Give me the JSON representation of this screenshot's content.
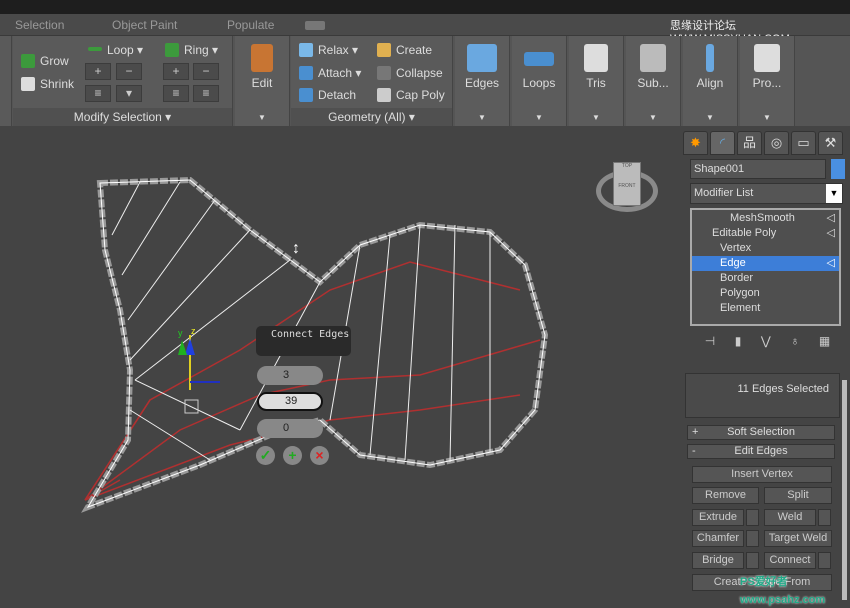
{
  "tabs": [
    "Selection",
    "Object Paint",
    "Populate"
  ],
  "modify_selection": {
    "title": "Modify Selection",
    "grow": "Grow",
    "shrink": "Shrink",
    "loop": "Loop",
    "ring": "Ring"
  },
  "edit": {
    "label": "Edit"
  },
  "geometry": {
    "title": "Geometry (All)",
    "relax": "Relax",
    "attach": "Attach",
    "detach": "Detach",
    "create": "Create",
    "collapse": "Collapse",
    "cap_poly": "Cap Poly"
  },
  "big_buttons": [
    "Edges",
    "Loops",
    "Tris",
    "Sub...",
    "Align",
    "Pro..."
  ],
  "watermark_top": "思缘设计论坛 WWW.MISSYUAN.COM",
  "panel": {
    "object_name": "Shape001",
    "object_color": "#4a90e2",
    "modifier_list": "Modifier List",
    "stack": [
      "MeshSmooth",
      "Editable Poly",
      "Vertex",
      "Edge",
      "Border",
      "Polygon",
      "Element"
    ],
    "selected": "Edge",
    "selection_info": "11 Edges Selected",
    "soft_selection": "Soft Selection",
    "edit_edges": "Edit Edges",
    "buttons": {
      "insert_vertex": "Insert Vertex",
      "remove": "Remove",
      "split": "Split",
      "extrude": "Extrude",
      "weld": "Weld",
      "chamfer": "Chamfer",
      "target_weld": "Target Weld",
      "bridge": "Bridge",
      "connect": "Connect",
      "create_shape": "Create Shape From Selection"
    }
  },
  "caddy": {
    "title": "Connect Edges",
    "segments": "3",
    "pinch": "39",
    "slide": "0"
  },
  "viewcube": {
    "top": "TOP",
    "front": "FRONT"
  },
  "gizmo": {
    "y": "y",
    "z": "z"
  },
  "watermark_bottom": "PS爱好者 www.psahz.com"
}
